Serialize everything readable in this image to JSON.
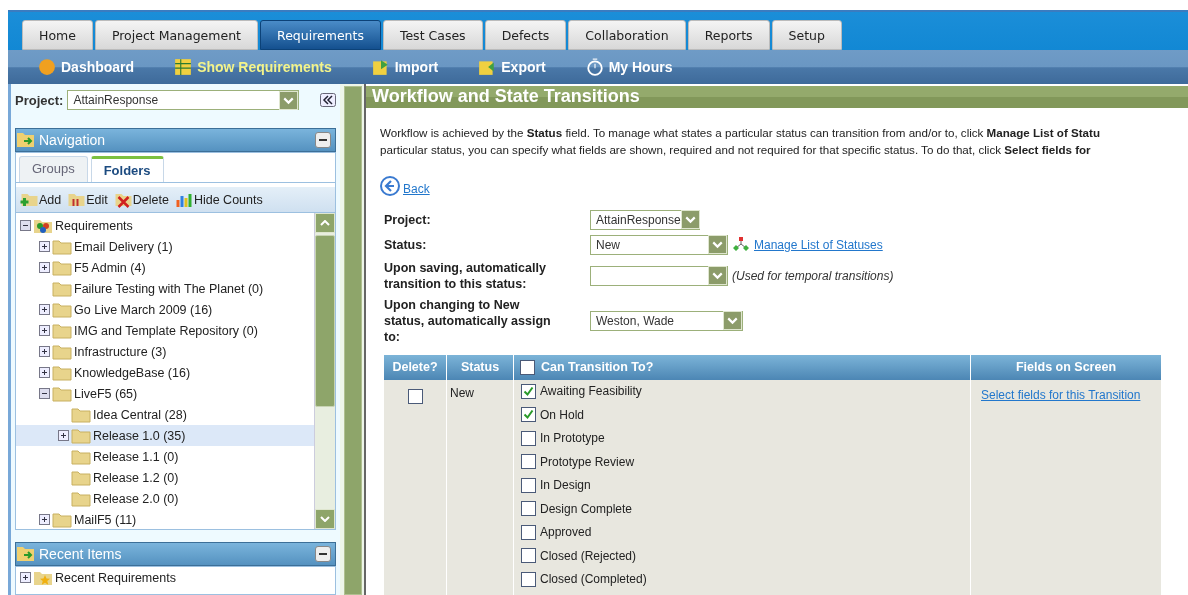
{
  "tabs": [
    {
      "label": "Home",
      "selected": false
    },
    {
      "label": "Project Management",
      "selected": false
    },
    {
      "label": "Requirements",
      "selected": true
    },
    {
      "label": "Test Cases",
      "selected": false
    },
    {
      "label": "Defects",
      "selected": false
    },
    {
      "label": "Collaboration",
      "selected": false
    },
    {
      "label": "Reports",
      "selected": false
    },
    {
      "label": "Setup",
      "selected": false
    }
  ],
  "subnav": [
    {
      "label": "Dashboard",
      "kind": "dashboard",
      "selected": false
    },
    {
      "label": "Show Requirements",
      "kind": "grid",
      "selected": true
    },
    {
      "label": "Import",
      "kind": "import",
      "selected": false
    },
    {
      "label": "Export",
      "kind": "export",
      "selected": false
    },
    {
      "label": "My Hours",
      "kind": "stopwatch",
      "selected": false
    }
  ],
  "sidebar": {
    "project_label": "Project:",
    "project_value": "AttainResponse",
    "navigation": {
      "title": "Navigation",
      "tabs": [
        {
          "label": "Groups",
          "selected": false
        },
        {
          "label": "Folders",
          "selected": true
        }
      ],
      "toolbar": [
        {
          "label": "Add",
          "kind": "add"
        },
        {
          "label": "Edit",
          "kind": "edit"
        },
        {
          "label": "Delete",
          "kind": "delete"
        },
        {
          "label": "Hide Counts",
          "kind": "counts"
        }
      ],
      "tree": [
        {
          "label": "Requirements",
          "kind": "root",
          "expanded": true,
          "selected": false,
          "children": [
            {
              "label": "Email Delivery (1)",
              "kind": "branch",
              "expanded": false,
              "selected": false
            },
            {
              "label": "F5 Admin (4)",
              "kind": "branch",
              "expanded": false,
              "selected": false
            },
            {
              "label": "Failure Testing with The Planet (0)",
              "kind": "leaf",
              "selected": false
            },
            {
              "label": "Go Live March 2009 (16)",
              "kind": "branch",
              "expanded": false,
              "selected": false
            },
            {
              "label": "IMG and Template Repository (0)",
              "kind": "branch",
              "expanded": false,
              "selected": false
            },
            {
              "label": "Infrastructure (3)",
              "kind": "branch",
              "expanded": false,
              "selected": false
            },
            {
              "label": "KnowledgeBase (16)",
              "kind": "branch",
              "expanded": false,
              "selected": false
            },
            {
              "label": "LiveF5 (65)",
              "kind": "branch",
              "expanded": true,
              "selected": false,
              "children": [
                {
                  "label": "Idea Central (28)",
                  "kind": "leaf",
                  "selected": false
                },
                {
                  "label": "Release 1.0 (35)",
                  "kind": "branch",
                  "expanded": false,
                  "selected": true
                },
                {
                  "label": "Release 1.1 (0)",
                  "kind": "leaf",
                  "selected": false
                },
                {
                  "label": "Release 1.2 (0)",
                  "kind": "leaf",
                  "selected": false
                },
                {
                  "label": "Release 2.0 (0)",
                  "kind": "leaf",
                  "selected": false
                }
              ]
            },
            {
              "label": "MailF5 (11)",
              "kind": "branch",
              "expanded": false,
              "selected": false
            }
          ]
        }
      ]
    },
    "recent": {
      "title": "Recent Items",
      "items": [
        {
          "label": "Recent Requirements",
          "expanded": false
        }
      ]
    }
  },
  "main": {
    "title": "Workflow and State Transitions",
    "intro": [
      "Workflow is achieved by the **Status** field. To manage what states a particular status can transition from and/or to, click **Manage List of Statu**",
      "particular status, you can specify what fields are shown, required and not required for that specific status.  To do that, click **Select fields for**"
    ],
    "back": "Back",
    "form": [
      {
        "label": "Project:",
        "value": "AttainResponse",
        "kind": "short"
      },
      {
        "label": "Status:",
        "value": "New",
        "kind": "medium",
        "link": "Manage List of Statuses"
      },
      {
        "label": "Upon saving, automatically transition to this status:",
        "kind": "medium",
        "note": "(Used for temporal transitions)"
      },
      {
        "label": "Upon changing to New status, automatically assign to:",
        "value": "Weston, Wade",
        "kind": "long"
      }
    ],
    "table": {
      "columns": [
        "Delete?",
        "Status",
        "Can Transition To?",
        "Fields on Screen"
      ],
      "select_all_checked": false,
      "rows": [
        {
          "delete": false,
          "status": "New",
          "link": "Select fields for this Transition",
          "transitions": [
            {
              "label": "Awaiting Feasibility",
              "checked": true
            },
            {
              "label": "On Hold",
              "checked": true
            },
            {
              "label": "In Prototype",
              "checked": false
            },
            {
              "label": "Prototype Review",
              "checked": false
            },
            {
              "label": "In Design",
              "checked": false
            },
            {
              "label": "Design Complete",
              "checked": false
            },
            {
              "label": "Approved",
              "checked": false
            },
            {
              "label": "Closed (Rejected)",
              "checked": false
            },
            {
              "label": "Closed (Completed)",
              "checked": false
            }
          ]
        }
      ]
    }
  }
}
